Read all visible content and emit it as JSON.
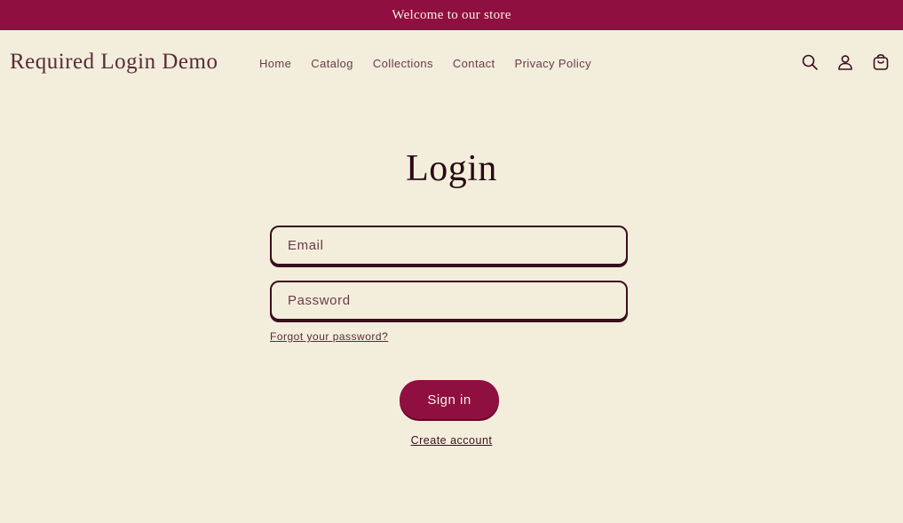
{
  "announcement": {
    "text": "Welcome to our store"
  },
  "header": {
    "logo": "Required Login Demo",
    "nav": [
      {
        "label": "Home"
      },
      {
        "label": "Catalog"
      },
      {
        "label": "Collections"
      },
      {
        "label": "Contact"
      },
      {
        "label": "Privacy Policy"
      }
    ],
    "icons": [
      "search-icon",
      "account-icon",
      "cart-icon"
    ]
  },
  "login": {
    "title": "Login",
    "email_placeholder": "Email",
    "email_value": "",
    "password_placeholder": "Password",
    "password_value": "",
    "forgot_label": "Forgot your password?",
    "signin_label": "Sign in",
    "create_label": "Create account"
  },
  "colors": {
    "background": "#f3eedc",
    "accent": "#8f0f40",
    "text": "#3a0f1e"
  }
}
